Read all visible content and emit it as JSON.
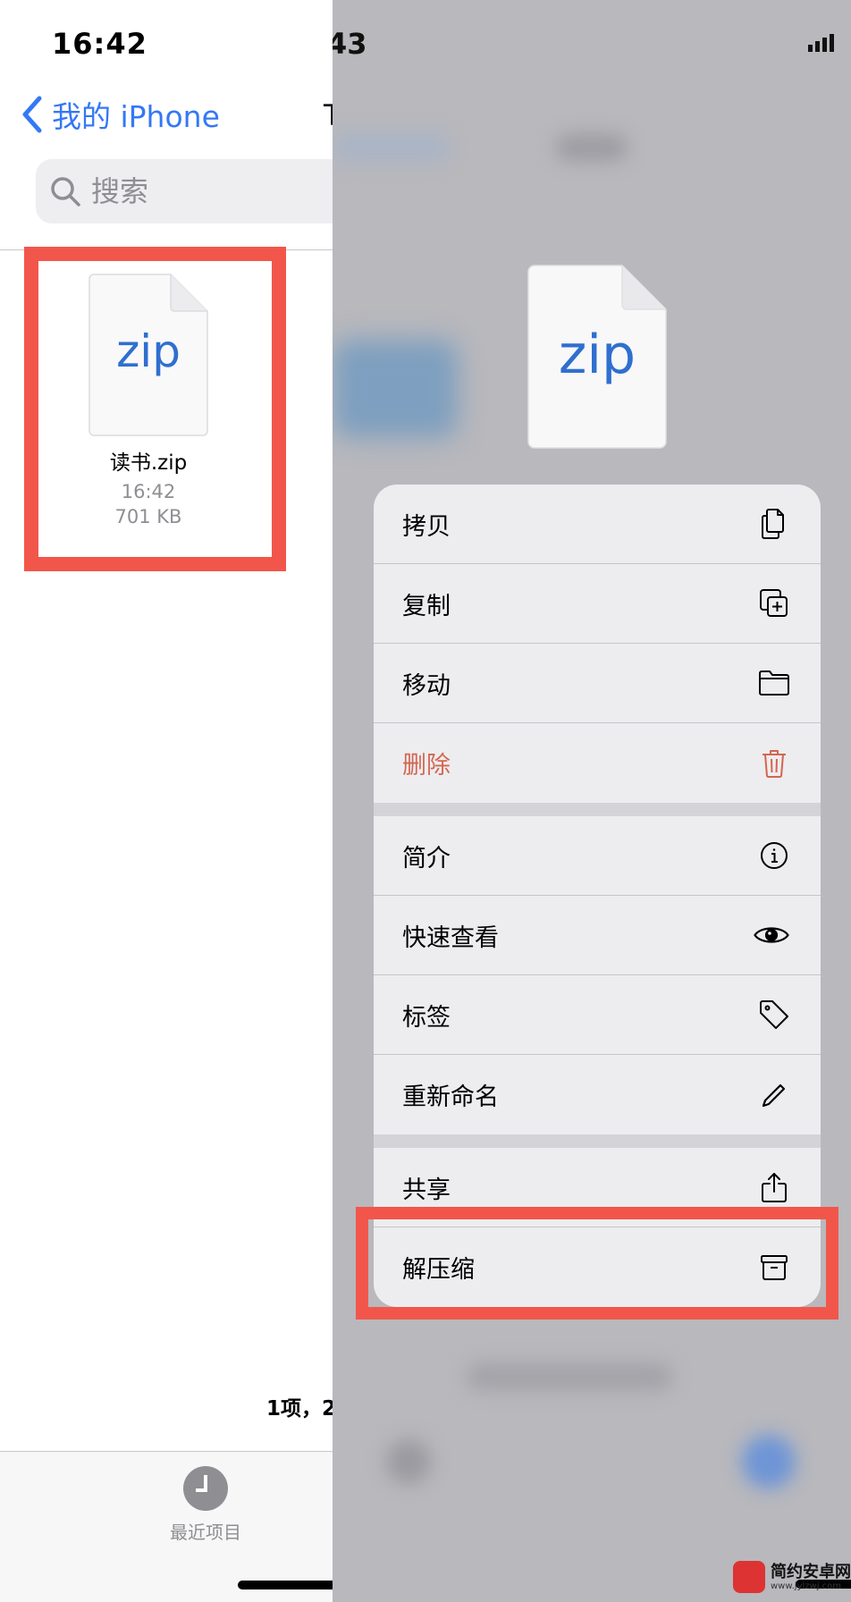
{
  "status_bar": {
    "time_left": "16:42",
    "time_right_peek": "43"
  },
  "files": {
    "back_label": "我的 iPhone",
    "title_peek": "T",
    "search_placeholder": "搜索",
    "item": {
      "icon_text": "zip",
      "name": "读书.zip",
      "time": "16:42",
      "size": "701 KB"
    },
    "item_count": "1项，2",
    "tab_recent_label": "最近项目"
  },
  "preview": {
    "icon_text": "zip"
  },
  "menu": {
    "groups": [
      [
        {
          "label": "拷贝",
          "icon": "copy-icon"
        },
        {
          "label": "复制",
          "icon": "duplicate-icon"
        },
        {
          "label": "移动",
          "icon": "folder-icon"
        },
        {
          "label": "删除",
          "icon": "trash-icon",
          "destructive": true
        }
      ],
      [
        {
          "label": "简介",
          "icon": "info-icon"
        },
        {
          "label": "快速查看",
          "icon": "eye-icon"
        },
        {
          "label": "标签",
          "icon": "tag-icon"
        },
        {
          "label": "重新命名",
          "icon": "pencil-icon"
        }
      ],
      [
        {
          "label": "共享",
          "icon": "share-icon"
        },
        {
          "label": "解压缩",
          "icon": "archive-icon"
        }
      ]
    ]
  },
  "colors": {
    "accent": "#3478f6",
    "destructive": "#d4664f",
    "highlight": "#f2564b"
  },
  "watermark": {
    "title": "简约安卓网",
    "url": "www.jylzwj.com"
  }
}
